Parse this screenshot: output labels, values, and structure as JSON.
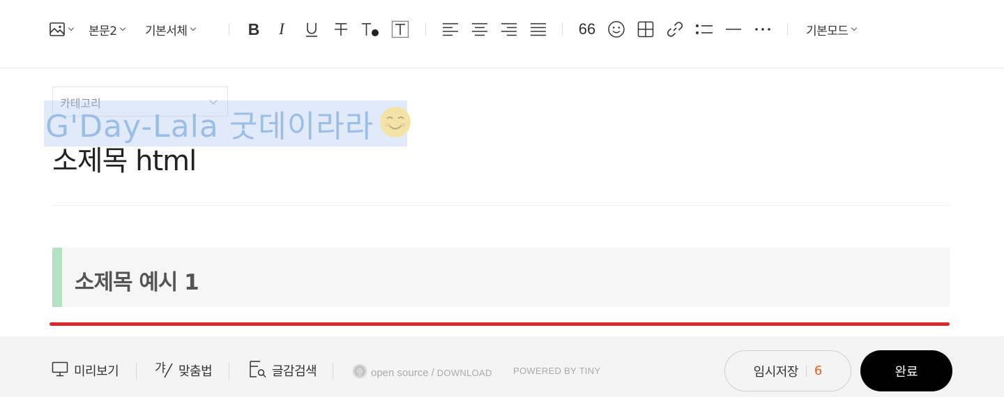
{
  "toolbar": {
    "image_icon": "image-icon",
    "paragraph_style": "본문2",
    "font_family": "기본서체",
    "quote_label": "66",
    "mode": "기본모드",
    "icons": [
      "image-icon",
      "bold-icon",
      "italic-icon",
      "underline-icon",
      "strikethrough-icon",
      "text-color-icon",
      "text-background-icon",
      "align-left-icon",
      "align-center-icon",
      "align-right-icon",
      "align-justify-icon",
      "quote-icon",
      "emoji-icon",
      "table-icon",
      "link-icon",
      "list-icon",
      "horizontal-rule-icon",
      "more-icon"
    ]
  },
  "editor": {
    "category_placeholder": "카테고리",
    "watermark_text": "G'Day-Lala 굿데이라라",
    "title": "소제목 html",
    "subheading": "소제목 예시 1"
  },
  "bottom": {
    "preview": "미리보기",
    "spellcheck": "맞춤법",
    "search": "글감검색",
    "open_source": "open source",
    "download": "DOWNLOAD",
    "powered": "POWERED BY TINY",
    "draft_label": "임시저장",
    "draft_count": "6",
    "done": "완료"
  },
  "colors": {
    "accent_red": "#d9262f",
    "subheading_bar": "#b5e2c2",
    "draft_count": "#e0621e",
    "done_bg": "#000000"
  }
}
